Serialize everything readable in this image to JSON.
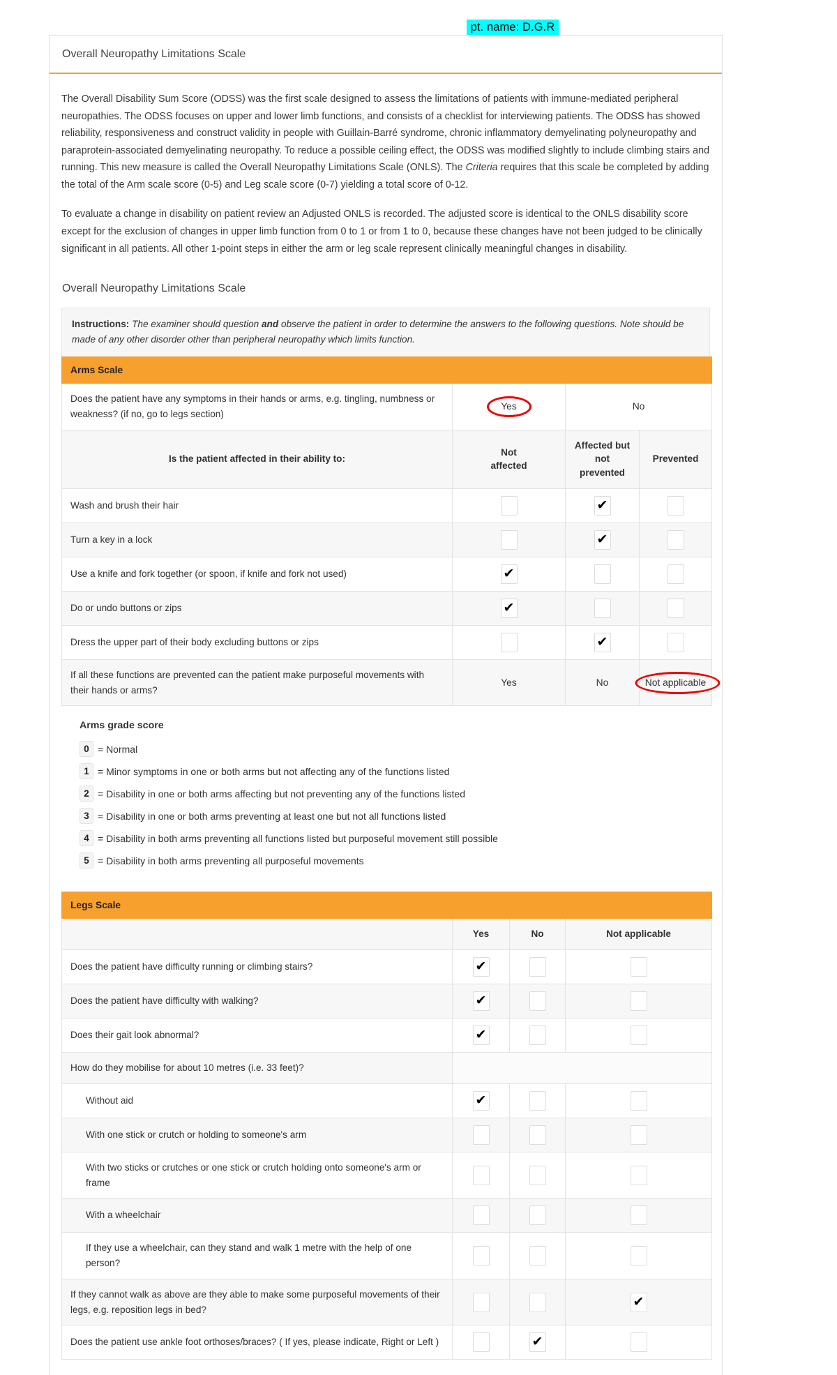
{
  "annotation": {
    "patient_name": "pt. name: D.G.R"
  },
  "header": {
    "title": "Overall Neuropathy Limitations Scale"
  },
  "intro": {
    "p1": "The Overall Disability Sum Score (ODSS) was the first scale designed to assess the limitations of patients with immune-mediated peripheral neuropathies. The ODSS focuses on upper and lower limb functions, and consists of a checklist for interviewing patients. The ODSS has showed reliability, responsiveness and construct validity in people with Guillain-Barré syndrome, chronic inflammatory demyelinating polyneuropathy and paraprotein-associated demyelinating neuropathy. To reduce a possible ceiling effect, the ODSS was modified slightly to include climbing stairs and running. This new measure is called the Overall Neuropathy Limitations Scale (ONLS). The ",
    "p1_italic": "Criteria",
    "p1_end": " requires that this scale be completed by adding the total of the Arm scale score (0-5) and Leg scale score (0-7) yielding a total score of 0-12.",
    "p2": "To evaluate a change in disability on patient review an Adjusted ONLS is recorded. The adjusted score is identical to the ONLS disability score except for the exclusion of changes in upper limb function from 0 to 1 or from 1 to 0, because these changes have not been judged to be clinically significant in all patients. All other 1-point steps in either the arm or leg scale represent clinically meaningful changes in disability."
  },
  "section_title": "Overall Neuropathy Limitations Scale",
  "instructions": {
    "label": "Instructions:",
    "text_a": " The examiner should question ",
    "bold_word": "and",
    "text_b": " observe the patient in order to determine the answers to the following questions. Note should be made of any other disorder other than peripheral neuropathy which limits function."
  },
  "arms": {
    "band_label": "Arms Scale",
    "screening_question": "Does the patient have any symptoms in their hands or arms, e.g. tingling, numbness or weakness? (if no, go to legs section)",
    "screening_options": [
      "Yes",
      "No"
    ],
    "screening_selected": "Yes",
    "ability_header": "Is the patient affected in their ability to:",
    "columns": [
      "Not affected",
      "Affected but not prevented",
      "Prevented"
    ],
    "col0_a": "Not",
    "col0_b": "affected",
    "col1_a": "Affected but not",
    "col1_b": "prevented",
    "col2": "Prevented",
    "rows": [
      {
        "label": "Wash and brush their hair",
        "checked": 1
      },
      {
        "label": "Turn a key in a lock",
        "checked": 1
      },
      {
        "label": "Use a knife and fork together (or spoon, if knife and fork not used)",
        "checked": 0
      },
      {
        "label": "Do or undo buttons or zips",
        "checked": 0
      },
      {
        "label": "Dress the upper part of their body excluding buttons or zips",
        "checked": 1
      }
    ],
    "purposeful_question": "If all these functions are prevented can the patient make purposeful movements with their hands or arms?",
    "purposeful_options": [
      "Yes",
      "No",
      "Not applicable"
    ],
    "purposeful_selected": "Not applicable",
    "grade_title": "Arms grade score",
    "grades": [
      {
        "score": "0",
        "text": "= Normal"
      },
      {
        "score": "1",
        "text": "= Minor symptoms in one or both arms but not affecting any of the functions listed"
      },
      {
        "score": "2",
        "text": "= Disability in one or both arms affecting but not preventing any of the functions listed"
      },
      {
        "score": "3",
        "text": "= Disability in one or both arms preventing at least one but not all functions listed"
      },
      {
        "score": "4",
        "text": "= Disability in both arms preventing all functions listed but purposeful movement still possible"
      },
      {
        "score": "5",
        "text": "= Disability in both arms preventing all purposeful movements"
      }
    ]
  },
  "legs": {
    "band_label": "Legs Scale",
    "columns": [
      "Yes",
      "No",
      "Not applicable"
    ],
    "rows": [
      {
        "label": "Does the patient have difficulty running or climbing stairs?",
        "indent": false,
        "checked": 0
      },
      {
        "label": "Does the patient have difficulty with walking?",
        "indent": false,
        "checked": 0
      },
      {
        "label": "Does their gait look abnormal?",
        "indent": false,
        "checked": 0
      },
      {
        "label": "How do they mobilise for about 10 metres (i.e. 33 feet)?",
        "indent": false,
        "checked": -2
      },
      {
        "label": "Without aid",
        "indent": true,
        "checked": 0
      },
      {
        "label": "With one stick or crutch or holding to someone's arm",
        "indent": true,
        "checked": -1
      },
      {
        "label": "With two sticks or crutches or one stick or crutch holding onto someone's arm or frame",
        "indent": true,
        "checked": -1
      },
      {
        "label": "With a wheelchair",
        "indent": true,
        "checked": -1
      },
      {
        "label": "If they use a wheelchair, can they stand and walk 1 metre with the help of one person?",
        "indent": true,
        "checked": -1
      },
      {
        "label": "If they cannot walk as above are they able to make some purposeful movements of their legs, e.g. reposition legs in bed?",
        "indent": false,
        "checked": 2
      },
      {
        "label": "Does the patient use ankle foot orthoses/braces? ( If yes, please indicate, Right or Left )",
        "indent": false,
        "checked": 1
      }
    ]
  },
  "colors": {
    "band_orange": "#F8A02E",
    "header_rule": "#F0A03C",
    "annotation_red": "#EE0000",
    "highlight_cyan": "#00FFFF"
  }
}
